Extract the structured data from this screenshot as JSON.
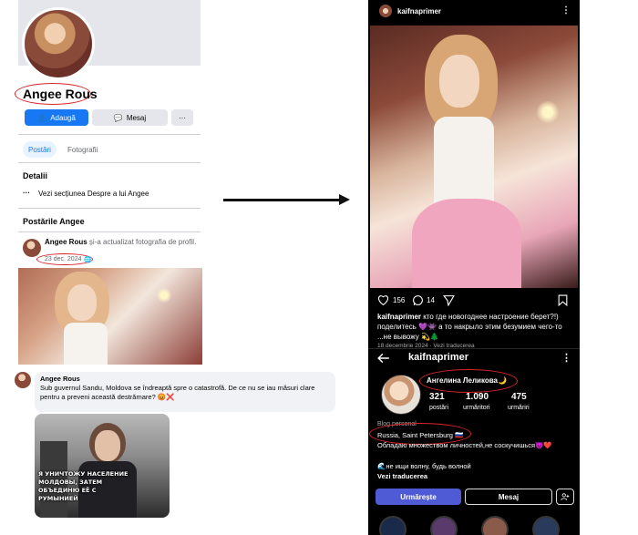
{
  "facebook": {
    "profile_name": "Angee Rous",
    "add_button": "Adaugă",
    "message_button": "Mesaj",
    "more_button": "···",
    "tabs": [
      "Postări",
      "Fotografii"
    ],
    "details_heading": "Detalii",
    "details_link": "Vezi secțiunea Despre a lui Angee",
    "posts_heading": "Postările Angee",
    "post": {
      "author": "Angee Rous",
      "action": "și-a actualizat fotografia de profil.",
      "date": "23 dec. 2024"
    },
    "comment": {
      "author": "Angee Rous",
      "text": "Sub guvernul Sandu, Moldova se îndreaptă spre o catastrofă. De ce nu se iau măsuri clare pentru a preveni această destrămare? 😡❌",
      "meme_text": "Я УНИЧТОЖУ НАСЕЛЕНИЕ МОЛДОВЫ, ЗАТЕМ ОБЪЕДИНЮ ЕЁ С РУМЫНИЕЙ"
    }
  },
  "instagram": {
    "username": "kaifnaprimer",
    "likes": "156",
    "comments": "14",
    "caption_user": "kaifnaprimer",
    "caption_text": "кто где новогоднее настроение берет?!) поделитесь 💜👾 а то накрыло этим безумием чего-то ...не вывожу 💫🌲",
    "date_line": "18 decembrie 2024 · Vezi traducerea",
    "profile_username": "kaifnaprimer",
    "display_name": "Ангелина Леликова🌙",
    "stats": [
      {
        "value": "321",
        "label": "postări"
      },
      {
        "value": "1.090",
        "label": "urmăritori"
      },
      {
        "value": "475",
        "label": "urmăriri"
      }
    ],
    "category": "Blog personal",
    "location": "Russia, Saint Petersburg 🇷🇺",
    "bio_line1": "Обладаю множеством личностей,не соскучишься😈❤️",
    "bio_line2": "🌊не ищи волну, будь волной",
    "see_translation": "Vezi traducerea",
    "follow_button": "Urmărește",
    "message_button": "Mesaj"
  },
  "colors": {
    "fb_blue": "#1877f2",
    "ig_follow": "#4f5bd5",
    "annotation_red": "#d8262b"
  }
}
